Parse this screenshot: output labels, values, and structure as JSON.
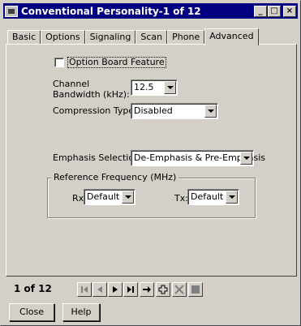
{
  "window": {
    "title": "Conventional Personality-1 of 12",
    "minimize": "_",
    "maximize": "□",
    "close": "×"
  },
  "tabs": [
    {
      "label": "Basic"
    },
    {
      "label": "Options"
    },
    {
      "label": "Signaling"
    },
    {
      "label": "Scan"
    },
    {
      "label": "Phone"
    },
    {
      "label": "Advanced",
      "active": true
    }
  ],
  "advanced": {
    "option_board_label": "Option Board Feature",
    "option_board_checked": false,
    "channel_bw_label": "Channel\nBandwidth (kHz):",
    "channel_bw_value": "12.5",
    "compression_label": "Compression Type:",
    "compression_value": "Disabled",
    "emphasis_label": "Emphasis Selection:",
    "emphasis_value": "De-Emphasis & Pre-Emphasis",
    "ref_freq_title": "Reference Frequency (MHz)",
    "rx_label": "Rx:",
    "rx_value": "Default",
    "tx_label": "Tx:",
    "tx_value": "Default"
  },
  "nav": {
    "counter": "1 of 12",
    "first_icon": "first-record-icon",
    "prev_icon": "previous-record-icon",
    "next_icon": "next-record-icon",
    "last_icon": "last-record-icon",
    "goto_icon": "goto-arrow-icon",
    "add_icon": "add-record-icon",
    "delete_icon": "delete-record-icon",
    "block_icon": "block-icon"
  },
  "buttons": {
    "close_label": "Close",
    "help_label": "Help"
  }
}
